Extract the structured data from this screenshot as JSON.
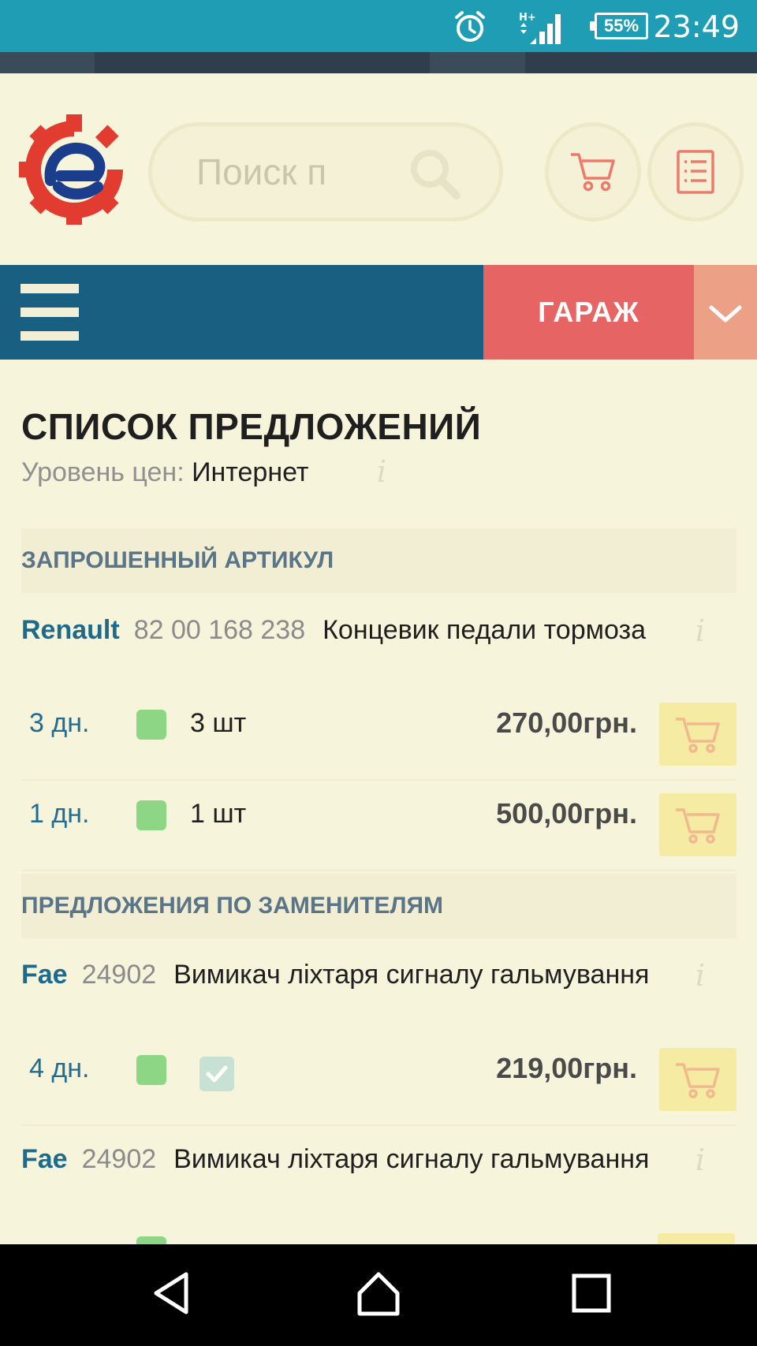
{
  "status_bar": {
    "time": "23:49",
    "battery": "55%",
    "network": "H+",
    "icons": [
      "alarm-icon",
      "signal-icon",
      "battery-icon"
    ]
  },
  "header": {
    "search_placeholder": "Поиск п",
    "logo_letter": "e"
  },
  "navbar": {
    "garage_label": "ГАРАЖ"
  },
  "page": {
    "title": "СПИСОК ПРЕДЛОЖЕНИЙ",
    "price_level_label": "Уровень цен:",
    "price_level_value": "Интернет",
    "info_glyph": "i"
  },
  "requested": {
    "section_title": "ЗАПРОШЕННЫЙ АРТИКУЛ",
    "product": {
      "brand": "Renault",
      "article": "82 00 168 238",
      "name": "Концевик педали тормоза"
    },
    "offers": [
      {
        "days": "3 дн.",
        "qty": "3 шт",
        "price": "270,00грн."
      },
      {
        "days": "1 дн.",
        "qty": "1 шт",
        "price": "500,00грн."
      }
    ]
  },
  "substitutes": {
    "section_title": "ПРЕДЛОЖЕНИЯ ПО ЗАМЕНИТЕЛЯМ",
    "products": [
      {
        "brand": "Fae",
        "article": "24902",
        "name": "Вимикач ліхтаря сигналу гальмування",
        "offer": {
          "days": "4 дн.",
          "price": "219,00грн."
        }
      },
      {
        "brand": "Fae",
        "article": "24902",
        "name": "Вимикач ліхтаря сигналу гальмування"
      }
    ]
  },
  "colors": {
    "status_bar": "#1f9db5",
    "navbar": "#195f81",
    "garage": "#e76464",
    "background": "#f7f4dc",
    "brand_text": "#1e6a8c",
    "stock_ok": "#8cd685",
    "cart_button": "#f5eba3"
  }
}
